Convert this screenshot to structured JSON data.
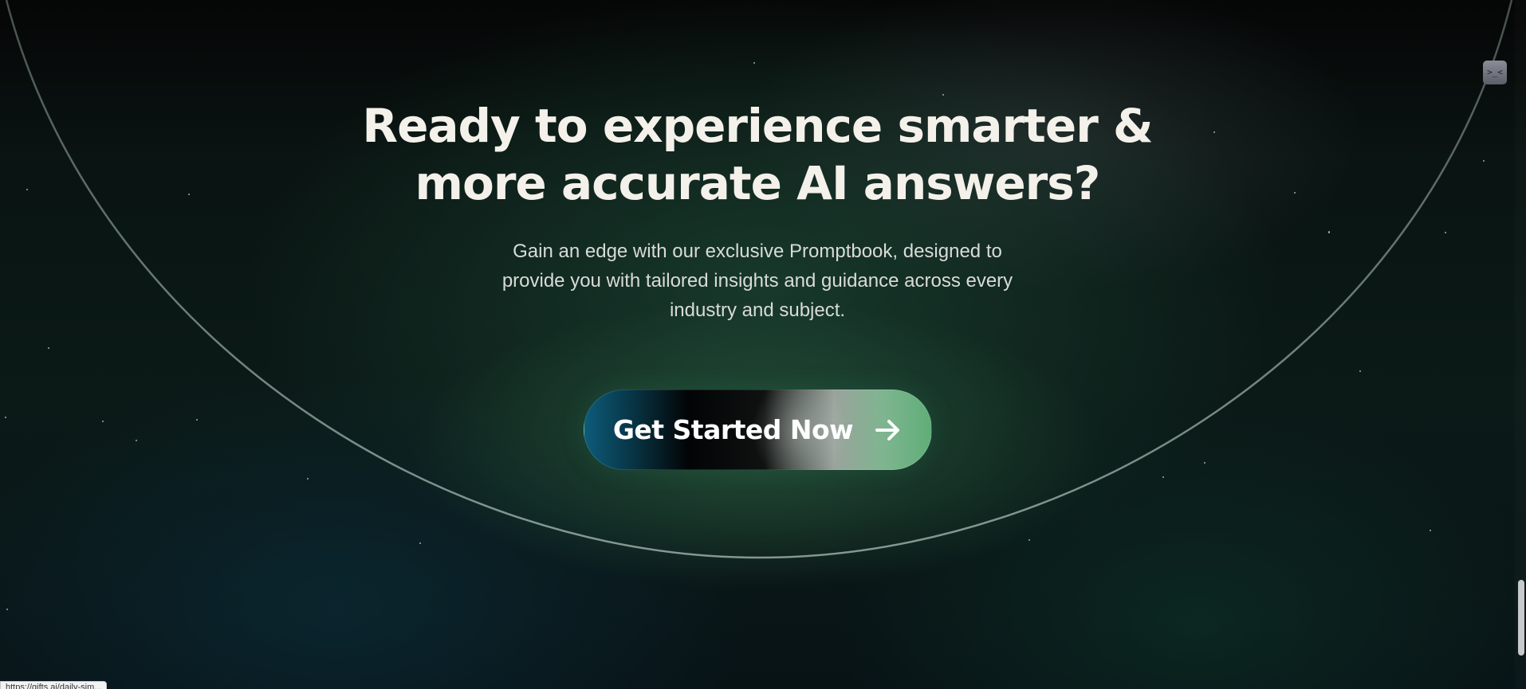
{
  "hero": {
    "headline_line1": "Ready to experience smarter &",
    "headline_line2": "more accurate AI answers?",
    "subtext_line1": "Gain an edge with our exclusive Promptbook, designed to",
    "subtext_line2": "provide you with tailored insights and guidance across every",
    "subtext_line3": "industry and subject."
  },
  "cta": {
    "label": "Get Started Now",
    "icon": "arrow-right-icon"
  },
  "widget": {
    "icon": "widget-face-icon",
    "glyph": ">_<"
  },
  "status_bar": {
    "url": "https://gifts.ai/daily-sim..."
  },
  "colors": {
    "headline": "#f4f1ea",
    "subtext": "#d9dbd8",
    "accent_green": "#5fae78",
    "accent_blue": "#0d5b7a"
  }
}
